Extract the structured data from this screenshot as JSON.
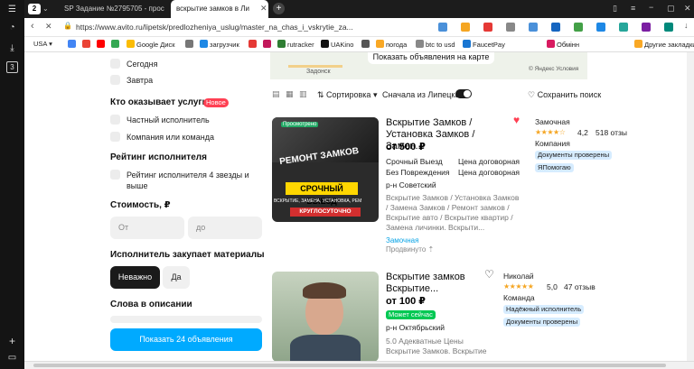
{
  "browser": {
    "tab_count": "2",
    "tabs": [
      {
        "label": "SP Задание №2795705 - прос"
      },
      {
        "label": "вскрытие замков в Ли"
      }
    ],
    "url": "https://www.avito.ru/lipetsk/predlozheniya_uslug/master_na_chas_i_vskrytie_za...",
    "bookmarks": [
      {
        "label": "USA",
        "color": "#fff"
      },
      {
        "label": "",
        "color": "#4285f4"
      },
      {
        "label": "",
        "color": "#ea4335"
      },
      {
        "label": "",
        "color": "#ff0000"
      },
      {
        "label": "",
        "color": "#34a853"
      },
      {
        "label": "Google Диск",
        "color": "#fbbc05"
      },
      {
        "label": "",
        "color": "#777"
      },
      {
        "label": "загрузчик",
        "color": "#1e88e5"
      },
      {
        "label": "",
        "color": "#e53935"
      },
      {
        "label": "",
        "color": "#c2185b"
      },
      {
        "label": "rutracker",
        "color": "#2e7d32"
      },
      {
        "label": "UAKino",
        "color": "#111"
      },
      {
        "label": "",
        "color": "#555"
      },
      {
        "label": "погода",
        "color": "#f9a825"
      },
      {
        "label": "btc to usd",
        "color": "#888"
      },
      {
        "label": "FaucetPay",
        "color": "#1976d2"
      },
      {
        "label": "Обмінн",
        "color": "#d81b60"
      },
      {
        "label": "Другие закладки",
        "color": "#f9a825"
      }
    ]
  },
  "map": {
    "place": "Задонск",
    "show_on_map": "Показать объявления на карте",
    "attribution": "© Яндекс Условия"
  },
  "filters": {
    "today": "Сегодня",
    "tomorrow": "Завтра",
    "who_heading": "Кто оказывает услуги",
    "new_badge": "Новое",
    "private": "Частный исполнитель",
    "company": "Компания или команда",
    "rating_heading": "Рейтинг исполнителя",
    "rating_option": "Рейтинг исполнителя 4 звезды и выше",
    "cost_heading": "Стоимость, ₽",
    "from_placeholder": "От",
    "to_placeholder": "до",
    "materials_heading": "Исполнитель закупает материалы",
    "materials_yes": "Да",
    "materials_no": "Неважно",
    "words_heading": "Слова в описании",
    "show_button": "Показать 24 объявления"
  },
  "toolbar": {
    "sort_label": "Сортировка",
    "first_lipetsk": "Сначала из Липецка",
    "save_search": "Сохранить поиск"
  },
  "listings": [
    {
      "title": "Вскрытие Замков / Установка Замков / Замен...",
      "price": "от 500 ₽",
      "tag1a": "Срочный Выезд",
      "tag1b": "Цена договорная",
      "tag2a": "Без Повреждения",
      "tag2b": "Цена договорная",
      "district": "р-н Советский",
      "desc": "Вскрытие Замков / Установка Замков / Замена Замков / Ремонт замков / Вскрытие авто / Вскрытие квартир / Замена личинки. Вскрыти...",
      "seller_label": "Замочная",
      "promo": "Продвинуто",
      "seller": "Замочная",
      "rating": "4,2",
      "reviews": "518 отзы",
      "seller_type": "Компания",
      "badges": [
        "Документы проверены",
        "ЯПомогаю"
      ],
      "image_text": {
        "top": "Просмотрено",
        "middle": "РЕМОНТ ЗАМКОВ",
        "action": "СРОЧНЫЙ ВЫЕЗД",
        "sub": "ВСКРЫТИЕ, ЗАМЕНА, УСТАНОВКА, РЕМ",
        "hours": "КРУГЛОСУТОЧНО"
      }
    },
    {
      "title": "Вскрытие замков Вскрытие...",
      "price": "от 100 ₽",
      "status": "Может сейчас",
      "district": "р-н Октябрьский",
      "desc": "5.0 Адекватные Цены Вскрытие Замков. Вскрытие",
      "seller": "Николай",
      "rating": "5,0",
      "reviews": "47 отзыв",
      "seller_type": "Команда",
      "badges": [
        "Надёжный исполнитель",
        "Документы проверены"
      ]
    }
  ]
}
